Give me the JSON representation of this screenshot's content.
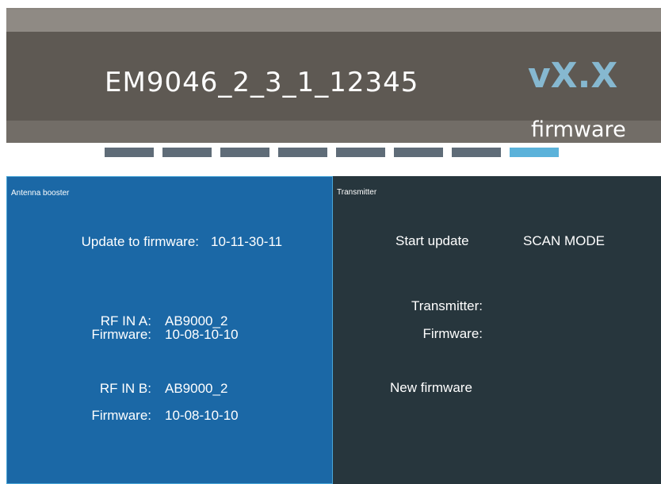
{
  "header": {
    "device_name": "EM9046_2_3_1_12345",
    "version": "vX.X",
    "firmware_label": "firmware"
  },
  "progress": {
    "total_steps": 8,
    "current_step": 8
  },
  "antenna_booster": {
    "title": "Antenna booster",
    "update_label": "Update to firmware:",
    "update_value": "10-11-30-11",
    "rf_in_a_label": "RF IN A:",
    "rf_in_a_value": "AB9000_2",
    "firmware_a_label": "Firmware:",
    "firmware_a_value": "10-08-10-10",
    "rf_in_b_label": "RF IN B:",
    "rf_in_b_value": "AB9000_2",
    "firmware_b_label": "Firmware:",
    "firmware_b_value": "10-08-10-10"
  },
  "transmitter": {
    "title": "Transmitter",
    "start_update_label": "Start update",
    "scan_mode_label": "SCAN MODE",
    "transmitter_label": "Transmitter:",
    "firmware_label": "Firmware:",
    "new_firmware_label": "New firmware"
  },
  "colors": {
    "header_bg": "#5e5953",
    "version_accent": "#86b8d0",
    "step_inactive": "#5f6c78",
    "step_active": "#5bb2da",
    "left_panel_bg": "#1b68a6",
    "right_panel_bg": "#27363d"
  }
}
